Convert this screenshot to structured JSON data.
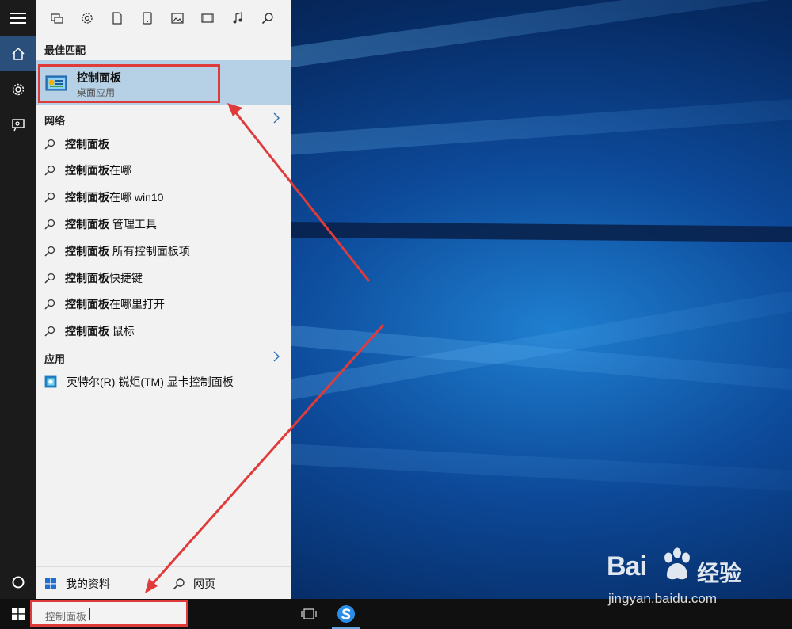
{
  "search": {
    "best_match_heading": "最佳匹配",
    "best_match": {
      "title": "控制面板",
      "subtitle": "桌面应用"
    },
    "web_heading": "网络",
    "web_results": [
      {
        "bold": "控制面板",
        "rest": ""
      },
      {
        "bold": "控制面板",
        "rest": "在哪"
      },
      {
        "bold": "控制面板",
        "rest": "在哪 win10"
      },
      {
        "bold": "控制面板",
        "rest": " 管理工具"
      },
      {
        "bold": "控制面板",
        "rest": " 所有控制面板项"
      },
      {
        "bold": "控制面板",
        "rest": "快捷键"
      },
      {
        "bold": "控制面板",
        "rest": "在哪里打开"
      },
      {
        "bold": "控制面板",
        "rest": " 鼠标"
      }
    ],
    "apps_heading": "应用",
    "apps": [
      {
        "label": "英特尔(R) 锐炬(TM) 显卡控制面板"
      }
    ],
    "bottom": {
      "my_data": "我的资料",
      "web": "网页"
    }
  },
  "taskbar": {
    "search_value": "控制面板"
  },
  "watermark": {
    "brand": "Bai",
    "brand2": "经验",
    "url": "jingyan.baidu.com"
  },
  "icons": {
    "rail": [
      "hamburger-icon",
      "home-icon",
      "settings-icon",
      "feedback-icon",
      "cortana-icon"
    ],
    "filters": [
      "apps-filter-icon",
      "settings-filter-icon",
      "document-icon",
      "tablet-icon",
      "photo-icon",
      "video-icon",
      "music-icon",
      "search-icon"
    ]
  },
  "colors": {
    "highlight": "#b6d0e6",
    "annotation": "#e03b3b",
    "rail_active": "#2a4f7a"
  }
}
